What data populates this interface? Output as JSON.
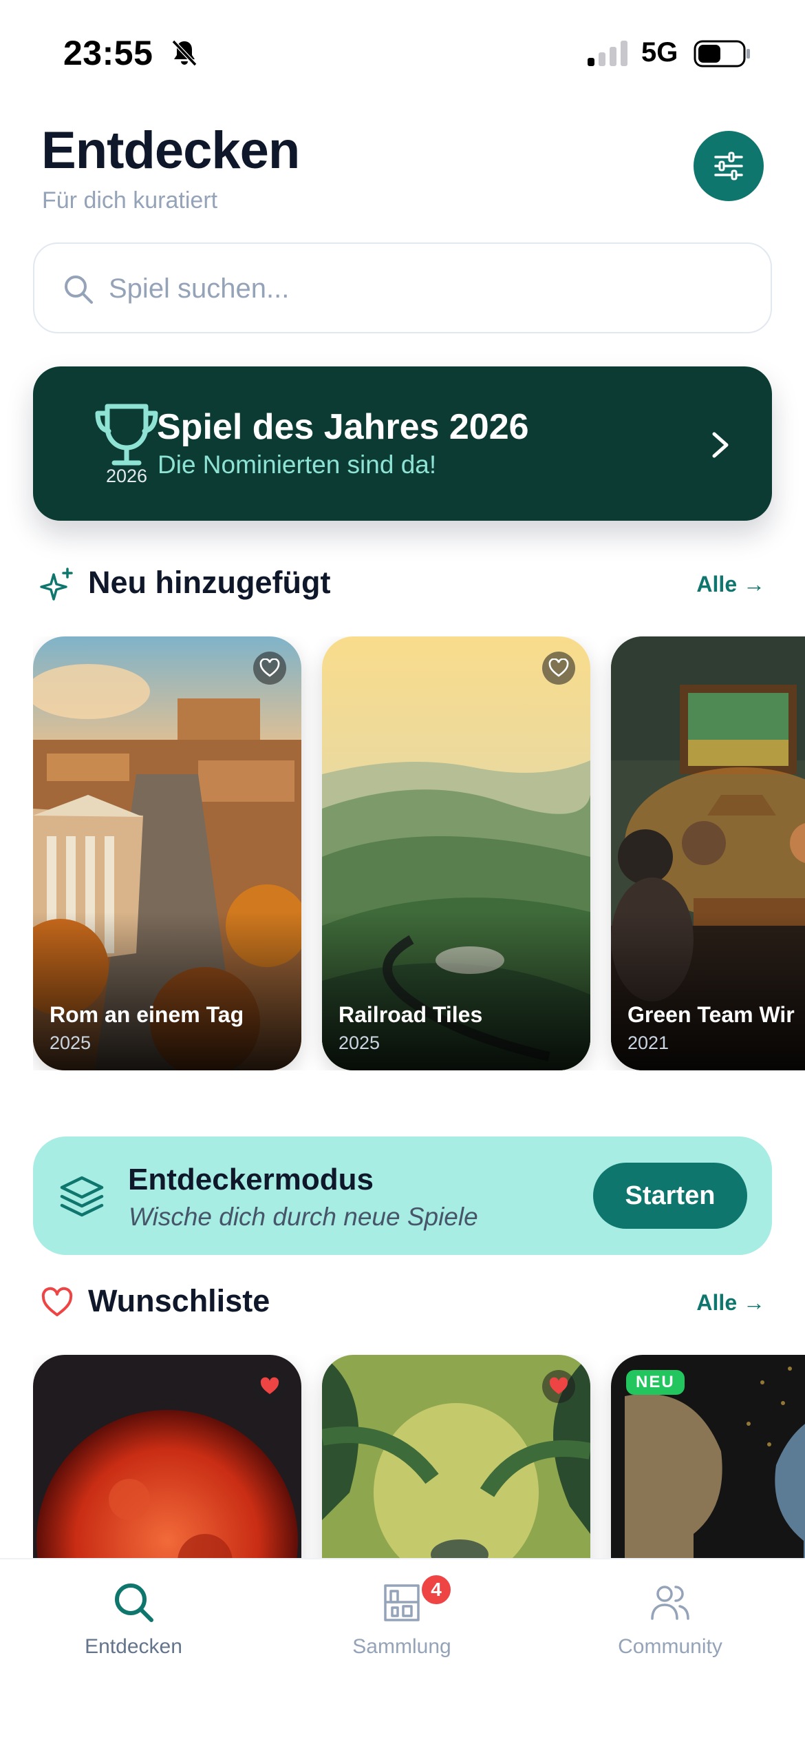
{
  "status_bar": {
    "time": "23:55",
    "network": "5G"
  },
  "header": {
    "title": "Entdecken",
    "subtitle": "Für dich kuratiert",
    "filter_icon": "sliders-icon"
  },
  "search": {
    "placeholder": "Spiel suchen..."
  },
  "banner": {
    "year": "2026",
    "title": "Spiel des Jahres 2026",
    "subtitle": "Die Nominierten sind da!"
  },
  "new_section": {
    "title": "Neu hinzugefügt",
    "link": "Alle →",
    "cards": [
      {
        "title": "Rom an einem Tag",
        "year": "2025",
        "favorite": false
      },
      {
        "title": "Railroad Tiles",
        "year": "2025",
        "favorite": false
      },
      {
        "title": "Green Team Wir",
        "year": "2021"
      }
    ]
  },
  "discover": {
    "title": "Entdeckermodus",
    "subtitle": "Wische dich durch neue Spiele",
    "button": "Starten"
  },
  "wishlist": {
    "title": "Wunschliste",
    "link": "Alle →",
    "cards": [
      {
        "favorite": true
      },
      {
        "favorite": true
      },
      {
        "badge": "NEU"
      }
    ]
  },
  "tabs": [
    {
      "label": "Entdecken",
      "icon": "search-icon",
      "active": true
    },
    {
      "label": "Sammlung",
      "icon": "shelf-icon",
      "badge": "4"
    },
    {
      "label": "Community",
      "icon": "users-icon"
    }
  ],
  "colors": {
    "accent": "#0f766e",
    "banner": "#0b3b33",
    "discover_bg": "#a7ede4",
    "heart": "#ef4444",
    "new_badge": "#22c55e"
  }
}
